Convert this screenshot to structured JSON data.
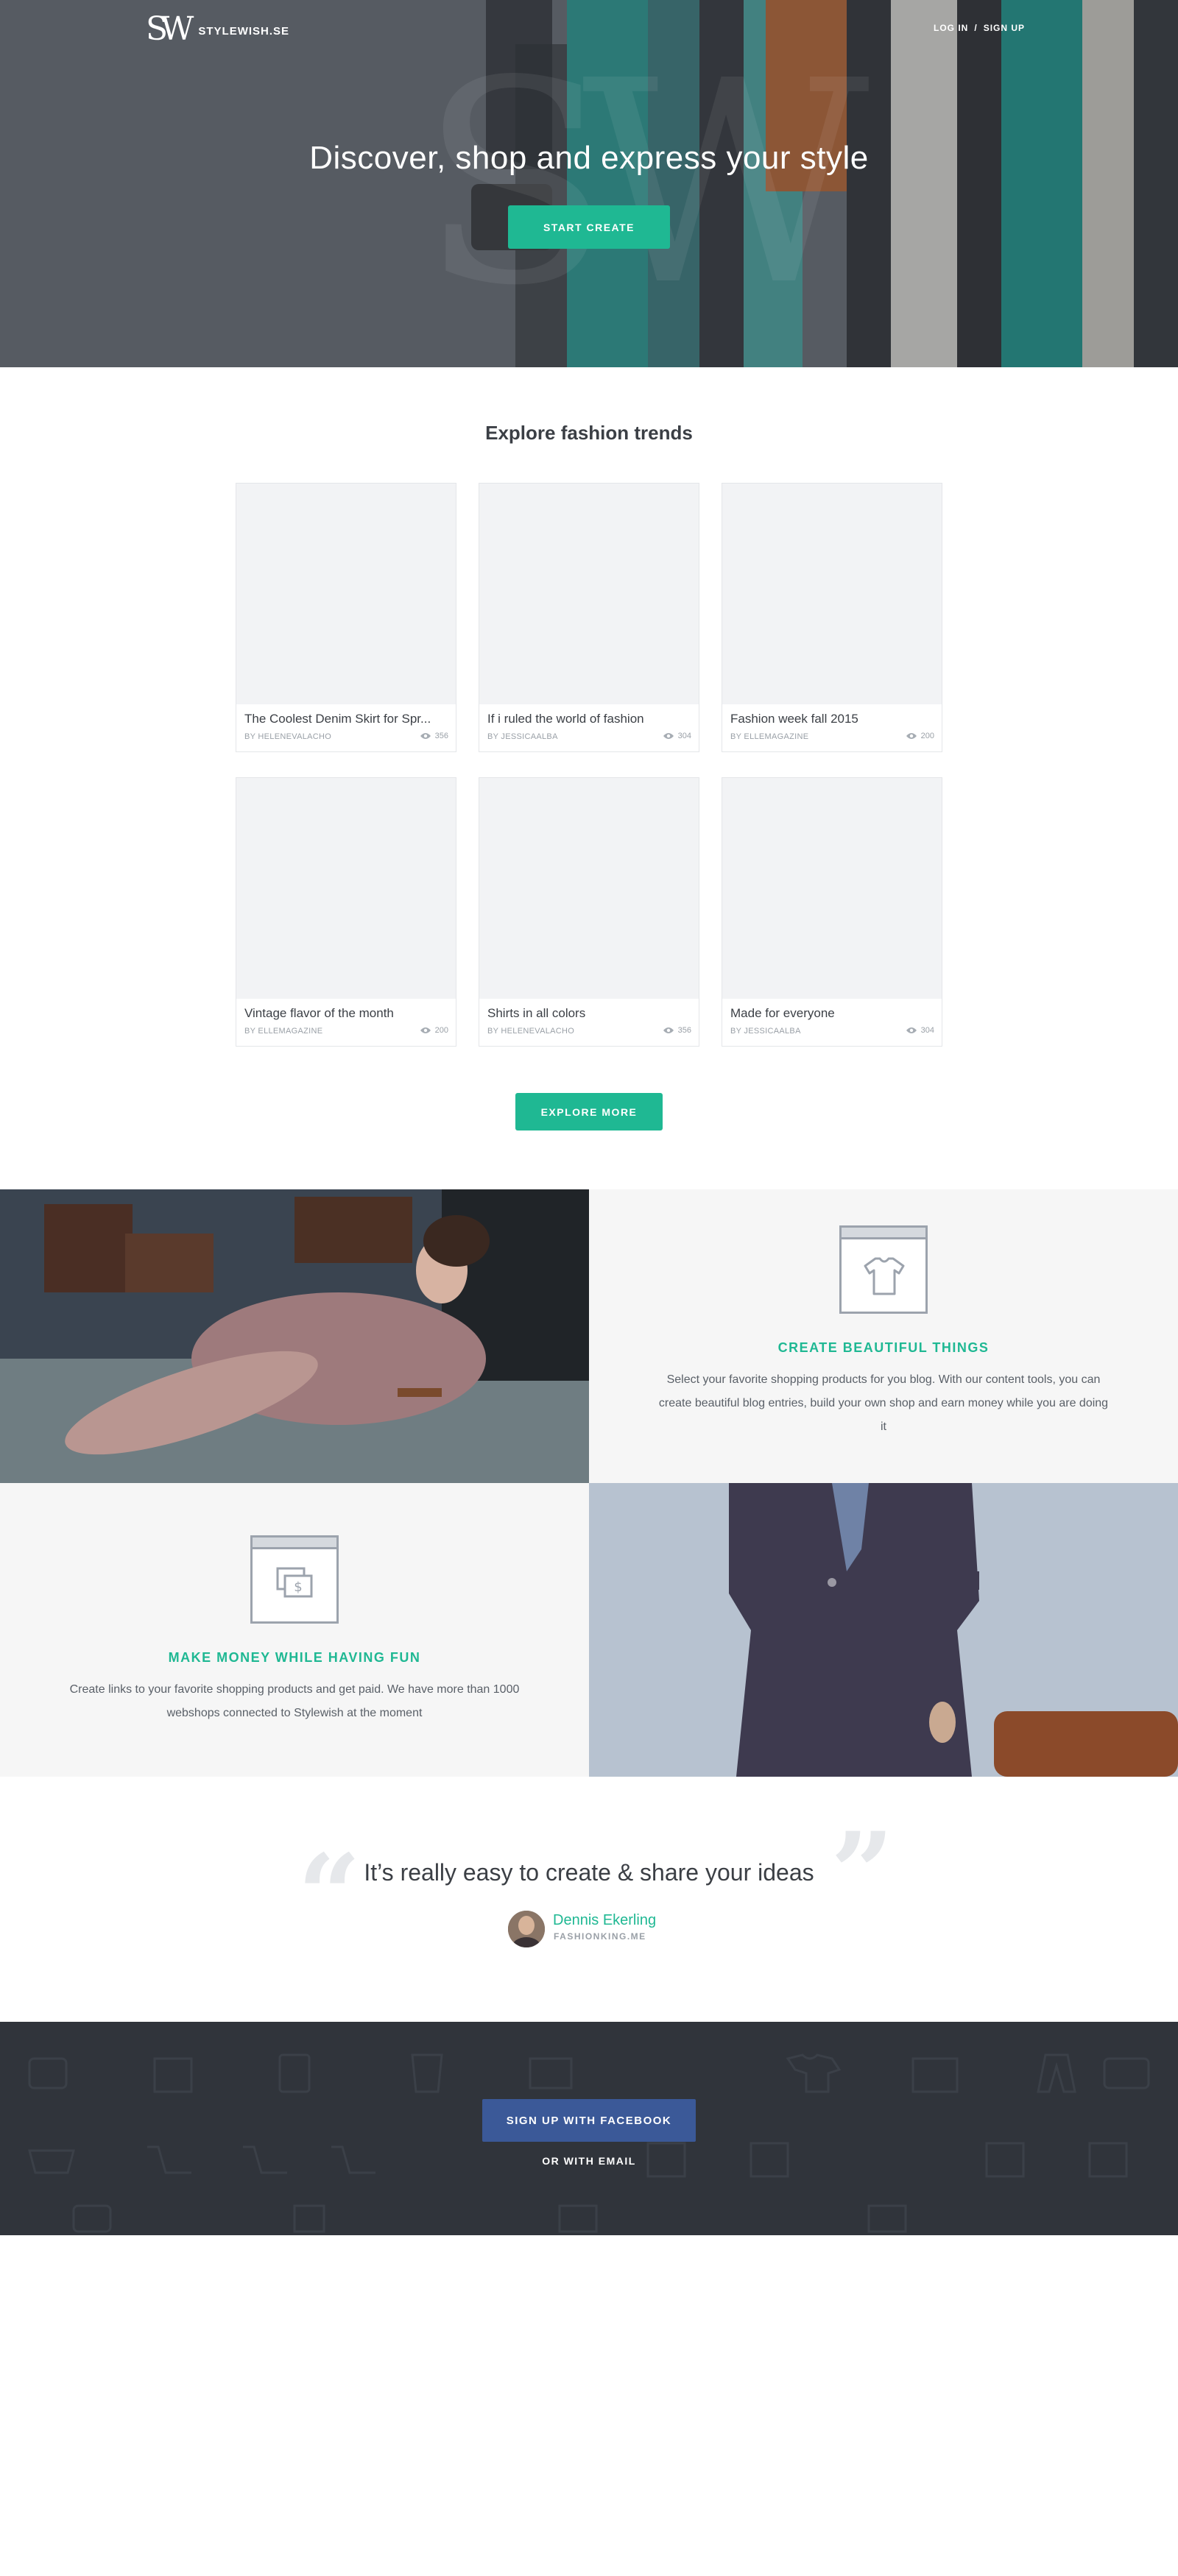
{
  "brand": {
    "mark": "SW",
    "name": "STYLEWISH.SE"
  },
  "auth": {
    "login": "LOG IN",
    "separator": "/",
    "signup": "SIGN UP"
  },
  "hero": {
    "title": "Discover, shop and express your style",
    "cta": "START CREATE"
  },
  "trends": {
    "title": "Explore fashion trends",
    "cards": [
      {
        "title": "The Coolest Denim Skirt for Spr...",
        "author": "BY HELENEVALACHO",
        "views": "356"
      },
      {
        "title": "If i ruled the world of fashion",
        "author": "BY JESSICAALBA",
        "views": "304"
      },
      {
        "title": "Fashion week fall 2015",
        "author": "BY ELLEMAGAZINE",
        "views": "200"
      },
      {
        "title": "Vintage flavor of the month",
        "author": "BY ELLEMAGAZINE",
        "views": "200"
      },
      {
        "title": "Shirts in all colors",
        "author": "BY HELENEVALACHO",
        "views": "356"
      },
      {
        "title": "Made for everyone",
        "author": "BY JESSICAALBA",
        "views": "304"
      }
    ],
    "more": "EXPLORE MORE"
  },
  "features": [
    {
      "icon": "tshirt-icon",
      "title": "CREATE BEAUTIFUL THINGS",
      "text": "Select your favorite shopping products for you blog. With our content tools, you can create beautiful blog entries, build your own shop and earn money while you are doing it"
    },
    {
      "icon": "money-icon",
      "title": "MAKE MONEY WHILE HAVING FUN",
      "text": "Create links to your favorite shopping products and get paid. We have more than 1000 webshops connected to Stylewish at the moment"
    }
  ],
  "quote": {
    "text": "It’s really easy to create & share your ideas",
    "name": "Dennis Ekerling",
    "site": "FASHIONKING.ME",
    "open": "“",
    "close": "”"
  },
  "signup": {
    "facebook": "SIGN UP WITH FACEBOOK",
    "email": "OR WITH EMAIL"
  },
  "colors": {
    "accent": "#1fb893",
    "facebook": "#3b5998",
    "dark": "#30343b"
  }
}
